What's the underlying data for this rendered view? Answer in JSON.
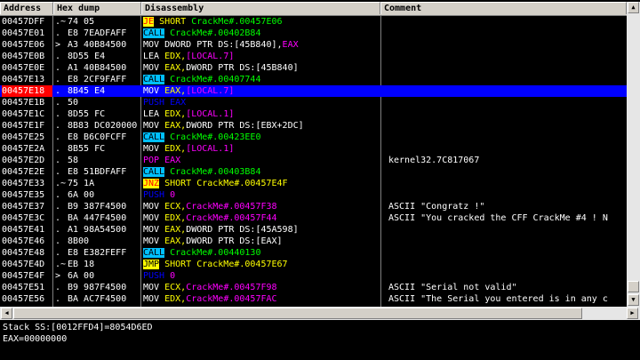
{
  "columns": {
    "address": "Address",
    "hex": "Hex dump",
    "disasm": "Disassembly",
    "comment": "Comment"
  },
  "rows": [
    {
      "addr": "00457DFF",
      "mark": ".~",
      "hex": "74 05",
      "parts": [
        [
          "JE",
          "jcc"
        ],
        [
          " SHORT ",
          "op"
        ],
        [
          "CrackMe#.00457E06",
          "tgt"
        ]
      ],
      "comment": ""
    },
    {
      "addr": "00457E01",
      "mark": ".",
      "hex": "E8 7EADFAFF",
      "parts": [
        [
          "CALL",
          "call"
        ],
        [
          " CrackMe#.00402B84",
          "tgt"
        ]
      ],
      "comment": ""
    },
    {
      "addr": "00457E06",
      "mark": ">",
      "hex": "A3 40B84500",
      "parts": [
        [
          "MOV DWORD PTR DS:[45B840],",
          "m"
        ],
        [
          "EAX",
          "lbl"
        ]
      ],
      "comment": ""
    },
    {
      "addr": "00457E0B",
      "mark": ".",
      "hex": "8D55 E4",
      "parts": [
        [
          "LEA ",
          "m"
        ],
        [
          "EDX,",
          "op"
        ],
        [
          "[LOCAL.7]",
          "lbl"
        ]
      ],
      "comment": ""
    },
    {
      "addr": "00457E0E",
      "mark": ".",
      "hex": "A1 40B84500",
      "parts": [
        [
          "MOV ",
          "m"
        ],
        [
          "EAX,",
          "op"
        ],
        [
          "DWORD PTR DS:[45B840]",
          "m"
        ]
      ],
      "comment": ""
    },
    {
      "addr": "00457E13",
      "mark": ".",
      "hex": "E8 2CF9FAFF",
      "parts": [
        [
          "CALL",
          "call"
        ],
        [
          " CrackMe#.00407744",
          "tgt"
        ]
      ],
      "comment": ""
    },
    {
      "addr": "00457E18",
      "mark": ".",
      "hex": "8B45 E4",
      "parts": [
        [
          "MOV ",
          "m"
        ],
        [
          "EAX,",
          "op"
        ],
        [
          "[LOCAL.7]",
          "lbl"
        ]
      ],
      "comment": "",
      "sel": true
    },
    {
      "addr": "00457E1B",
      "mark": ".",
      "hex": "50",
      "parts": [
        [
          "PUSH EAX",
          "push"
        ]
      ],
      "comment": ""
    },
    {
      "addr": "00457E1C",
      "mark": ".",
      "hex": "8D55 FC",
      "parts": [
        [
          "LEA ",
          "m"
        ],
        [
          "EDX,",
          "op"
        ],
        [
          "[LOCAL.1]",
          "lbl"
        ]
      ],
      "comment": ""
    },
    {
      "addr": "00457E1F",
      "mark": ".",
      "hex": "8B83 DC020000",
      "parts": [
        [
          "MOV ",
          "m"
        ],
        [
          "EAX,",
          "op"
        ],
        [
          "DWORD PTR DS:[EBX+2DC]",
          "m"
        ]
      ],
      "comment": ""
    },
    {
      "addr": "00457E25",
      "mark": ".",
      "hex": "E8 B6C0FCFF",
      "parts": [
        [
          "CALL",
          "call"
        ],
        [
          " CrackMe#.00423EE0",
          "tgt"
        ]
      ],
      "comment": ""
    },
    {
      "addr": "00457E2A",
      "mark": ".",
      "hex": "8B55 FC",
      "parts": [
        [
          "MOV ",
          "m"
        ],
        [
          "EDX,",
          "op"
        ],
        [
          "[LOCAL.1]",
          "lbl"
        ]
      ],
      "comment": ""
    },
    {
      "addr": "00457E2D",
      "mark": ".",
      "hex": "58",
      "parts": [
        [
          "POP EAX",
          "pushv"
        ]
      ],
      "comment": "kernel32.7C817067"
    },
    {
      "addr": "00457E2E",
      "mark": ".",
      "hex": "E8 51BDFAFF",
      "parts": [
        [
          "CALL",
          "call"
        ],
        [
          " CrackMe#.00403B84",
          "tgt"
        ]
      ],
      "comment": ""
    },
    {
      "addr": "00457E33",
      "mark": ".~",
      "hex": "75 1A",
      "parts": [
        [
          "JNZ",
          "jcc"
        ],
        [
          " SHORT CrackMe#.00457E4F",
          "op"
        ]
      ],
      "comment": ""
    },
    {
      "addr": "00457E35",
      "mark": ".",
      "hex": "6A 00",
      "parts": [
        [
          "PUSH ",
          "push"
        ],
        [
          "0",
          "pushv"
        ]
      ],
      "comment": ""
    },
    {
      "addr": "00457E37",
      "mark": ".",
      "hex": "B9 387F4500",
      "parts": [
        [
          "MOV ",
          "m"
        ],
        [
          "ECX,",
          "op"
        ],
        [
          "CrackMe#.00457F38",
          "num"
        ]
      ],
      "comment": "ASCII \"Congratz !\""
    },
    {
      "addr": "00457E3C",
      "mark": ".",
      "hex": "BA 447F4500",
      "parts": [
        [
          "MOV ",
          "m"
        ],
        [
          "EDX,",
          "op"
        ],
        [
          "CrackMe#.00457F44",
          "num"
        ]
      ],
      "comment": "ASCII \"You cracked the CFF CrackMe #4 ! N"
    },
    {
      "addr": "00457E41",
      "mark": ".",
      "hex": "A1 98A54500",
      "parts": [
        [
          "MOV ",
          "m"
        ],
        [
          "EAX,",
          "op"
        ],
        [
          "DWORD PTR DS:[45A598]",
          "m"
        ]
      ],
      "comment": ""
    },
    {
      "addr": "00457E46",
      "mark": ".",
      "hex": "8B00",
      "parts": [
        [
          "MOV ",
          "m"
        ],
        [
          "EAX,",
          "op"
        ],
        [
          "DWORD PTR DS:[EAX]",
          "m"
        ]
      ],
      "comment": ""
    },
    {
      "addr": "00457E48",
      "mark": ".",
      "hex": "E8 E382FEFF",
      "parts": [
        [
          "CALL",
          "call"
        ],
        [
          " CrackMe#.00440130",
          "tgt"
        ]
      ],
      "comment": ""
    },
    {
      "addr": "00457E4D",
      "mark": ".~",
      "hex": "EB 18",
      "parts": [
        [
          "JMP",
          "jmp"
        ],
        [
          " SHORT CrackMe#.00457E67",
          "op"
        ]
      ],
      "comment": ""
    },
    {
      "addr": "00457E4F",
      "mark": ">",
      "hex": "6A 00",
      "parts": [
        [
          "PUSH ",
          "push"
        ],
        [
          "0",
          "pushv"
        ]
      ],
      "comment": ""
    },
    {
      "addr": "00457E51",
      "mark": ".",
      "hex": "B9 987F4500",
      "parts": [
        [
          "MOV ",
          "m"
        ],
        [
          "ECX,",
          "op"
        ],
        [
          "CrackMe#.00457F98",
          "num"
        ]
      ],
      "comment": "ASCII \"Serial not valid\""
    },
    {
      "addr": "00457E56",
      "mark": ".",
      "hex": "BA AC7F4500",
      "parts": [
        [
          "MOV ",
          "m"
        ],
        [
          "EDX,",
          "op"
        ],
        [
          "CrackMe#.00457FAC",
          "num"
        ]
      ],
      "comment": "ASCII \"The Serial you entered is in any c"
    }
  ],
  "info": {
    "line1": "Stack SS:[0012FFD4]=8054D6ED",
    "line2": "EAX=00000000"
  },
  "colors": {
    "selection": "#0000ff",
    "current_eip": "#ff0000",
    "call_bg": "#00c0ff",
    "jump_bg": "#ffff00"
  }
}
